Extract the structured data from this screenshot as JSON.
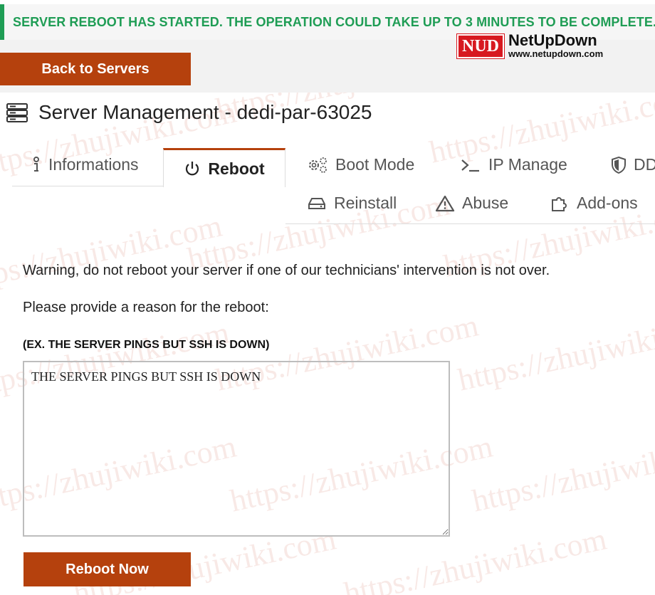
{
  "alert": {
    "text": "SERVER REBOOT HAS STARTED. THE OPERATION COULD TAKE UP TO 3 MINUTES TO BE COMPLETE."
  },
  "nav": {
    "back_label": "Back to Servers"
  },
  "logo": {
    "mark": "NUD",
    "name": "NetUpDown",
    "url": "www.netupdown.com"
  },
  "page": {
    "title": "Server Management - dedi-par-63025",
    "icon": "server-icon"
  },
  "tabs": [
    {
      "label": "Informations",
      "icon": "info-icon",
      "active": false
    },
    {
      "label": "Reboot",
      "icon": "power-icon",
      "active": true
    },
    {
      "label": "Boot Mode",
      "icon": "gears-icon",
      "active": false
    },
    {
      "label": "IP Manage",
      "icon": "terminal-icon",
      "active": false
    },
    {
      "label": "DD",
      "icon": "shield-icon",
      "active": false
    },
    {
      "label": "Reinstall",
      "icon": "hard-drive-icon",
      "active": false
    },
    {
      "label": "Abuse",
      "icon": "warning-icon",
      "active": false
    },
    {
      "label": "Add-ons",
      "icon": "puzzle-icon",
      "active": false
    }
  ],
  "content": {
    "warning": "Warning, do not reboot your server if one of our technicians' intervention is not over.",
    "prompt": "Please provide a reason for the reboot:",
    "field_label": "(EX. THE SERVER PINGS BUT SSH IS DOWN)",
    "reason_value": "THE SERVER PINGS BUT SSH IS DOWN",
    "submit_label": "Reboot Now"
  },
  "colors": {
    "accent": "#b5410d",
    "success": "#1f9d55"
  },
  "watermark": "https://zhujiwiki.com"
}
